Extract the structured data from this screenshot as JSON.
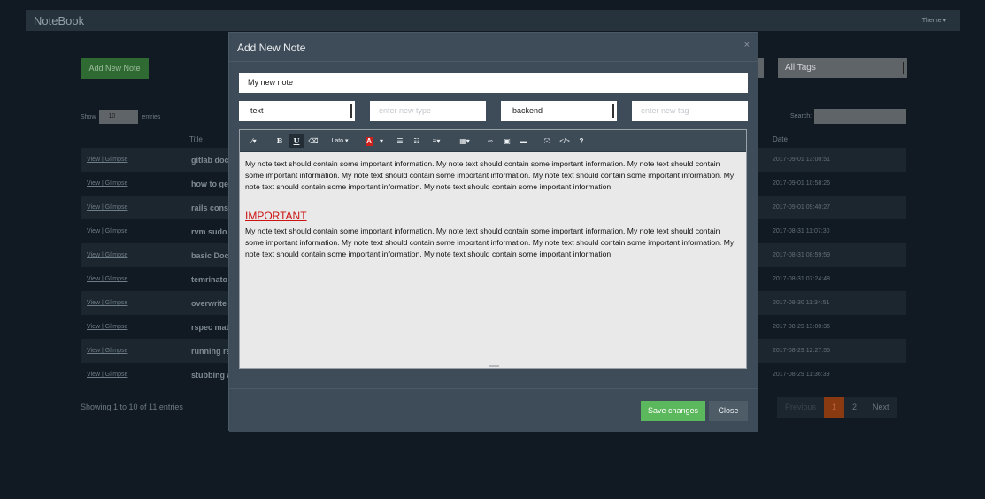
{
  "navbar": {
    "brand": "NoteBook",
    "theme_label": "Theme ▾"
  },
  "page": {
    "add_note_label": "Add New Note",
    "tags_select_value": "All Tags",
    "show_label": "Show",
    "entries_value": "10",
    "entries_label": "entries",
    "search_label": "Search:",
    "columns": {
      "title": "Title",
      "date": "Date"
    },
    "rows": [
      {
        "links": "View | Glimpse",
        "title": "gitlab docs",
        "date": "2017-09-01 13:00:51"
      },
      {
        "links": "View | Glimpse",
        "title": "how to ger",
        "date": "2017-09-01 10:58:26"
      },
      {
        "links": "View | Glimpse",
        "title": "rails conso",
        "date": "2017-09-01 09:40:27"
      },
      {
        "links": "View | Glimpse",
        "title": "rvm sudo i",
        "date": "2017-08-31 11:07:30"
      },
      {
        "links": "View | Glimpse",
        "title": "basic Dock",
        "date": "2017-08-31 08:59:59"
      },
      {
        "links": "View | Glimpse",
        "title": "temrinato",
        "date": "2017-08-31 07:24:48"
      },
      {
        "links": "View | Glimpse",
        "title": "overwrite",
        "date": "2017-08-30 11:34:51"
      },
      {
        "links": "View | Glimpse",
        "title": "rspec matc",
        "date": "2017-08-29 13:00:36"
      },
      {
        "links": "View | Glimpse",
        "title": "running rs",
        "date": "2017-08-29 12:27:55"
      },
      {
        "links": "View | Glimpse",
        "title": "stubbing a",
        "date": "2017-08-29 11:36:39"
      }
    ],
    "showing_text": "Showing 1 to 10 of 11 entries",
    "pagination": {
      "previous": "Previous",
      "page1": "1",
      "page2": "2",
      "next": "Next"
    }
  },
  "modal": {
    "title": "Add New Note",
    "close_symbol": "×",
    "note_title_value": "My new note",
    "type_select_value": "text",
    "type_placeholder": "enter new type",
    "tag_select_value": "backend",
    "tag_placeholder": "enter new tag",
    "toolbar": {
      "magic": "⁄▾",
      "bold": "B",
      "underline": "U",
      "eraser": "⌫",
      "font_name": "Lato ▾",
      "color_letter": "A",
      "color_caret": "▾",
      "ul": "☰",
      "ol": "☷",
      "align": "≡▾",
      "table": "▦▾",
      "link": "∞",
      "picture": "▣",
      "video": "▬",
      "fullscreen": "⤧",
      "code": "</>",
      "help": "?"
    },
    "content": {
      "paragraph1": "My note text should contain some important information. My note text should contain some important information. My note text should contain some important information. My note text should contain some important information. My note text should contain some important information. My note text should contain some important information. My note text should contain some important information.",
      "heading": "IMPORTANT",
      "paragraph2": "My note text should contain some important information. My note text should contain some important information. My note text should contain some important information. My note text should contain some important information. My note text should contain some important information. My note text should contain some important information. My note text should contain some important information."
    },
    "save_label": "Save changes",
    "close_label": "Close"
  },
  "colors": {
    "save_green": "#5cb85c",
    "important_red": "#cc1111",
    "pager_active": "#8a3a10"
  }
}
